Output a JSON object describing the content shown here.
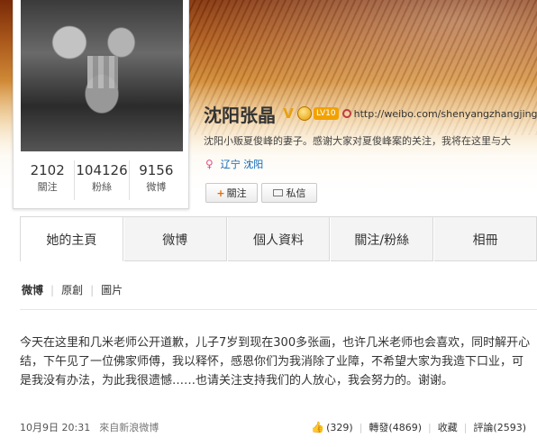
{
  "profile": {
    "name": "沈阳张晶",
    "verified_badge": "V",
    "level_badge": "LV10",
    "url": "http://weibo.com/shenyangzhangjing",
    "intro": "沈阳小贩夏俊峰的妻子。感谢大家对夏俊峰案的关注，我将在这里与大",
    "location": "辽宁 沈阳",
    "gender_icon": "female-icon",
    "follow_button": "關注",
    "message_button": "私信",
    "stats": [
      {
        "num": "2102",
        "label": "關注"
      },
      {
        "num": "104126",
        "label": "粉絲"
      },
      {
        "num": "9156",
        "label": "微博"
      }
    ]
  },
  "tabs": [
    "她的主頁",
    "微博",
    "個人資料",
    "關注/粉絲",
    "相冊"
  ],
  "subfilter": [
    "微博",
    "原創",
    "圖片"
  ],
  "post": {
    "text": "今天在这里和几米老师公开道歉，儿子7岁到现在300多张画，也许几米老师也会喜欢，同时解开心结，下午见了一位佛家师傅，我以释怀，感恩你们为我消除了业障，不希望大家为我造下口业，可是我没有办法，为此我很遗憾……也请关注支持我们的人放心，我会努力的。谢谢。",
    "time": "10月9日 20:31",
    "source": "來自新浪微博",
    "likes": "(329)",
    "repost": "轉發(4869)",
    "favorite": "收藏",
    "comment": "評論(2593)"
  },
  "colors": {
    "link": "#0a66b7",
    "accent": "#e8a10d"
  }
}
